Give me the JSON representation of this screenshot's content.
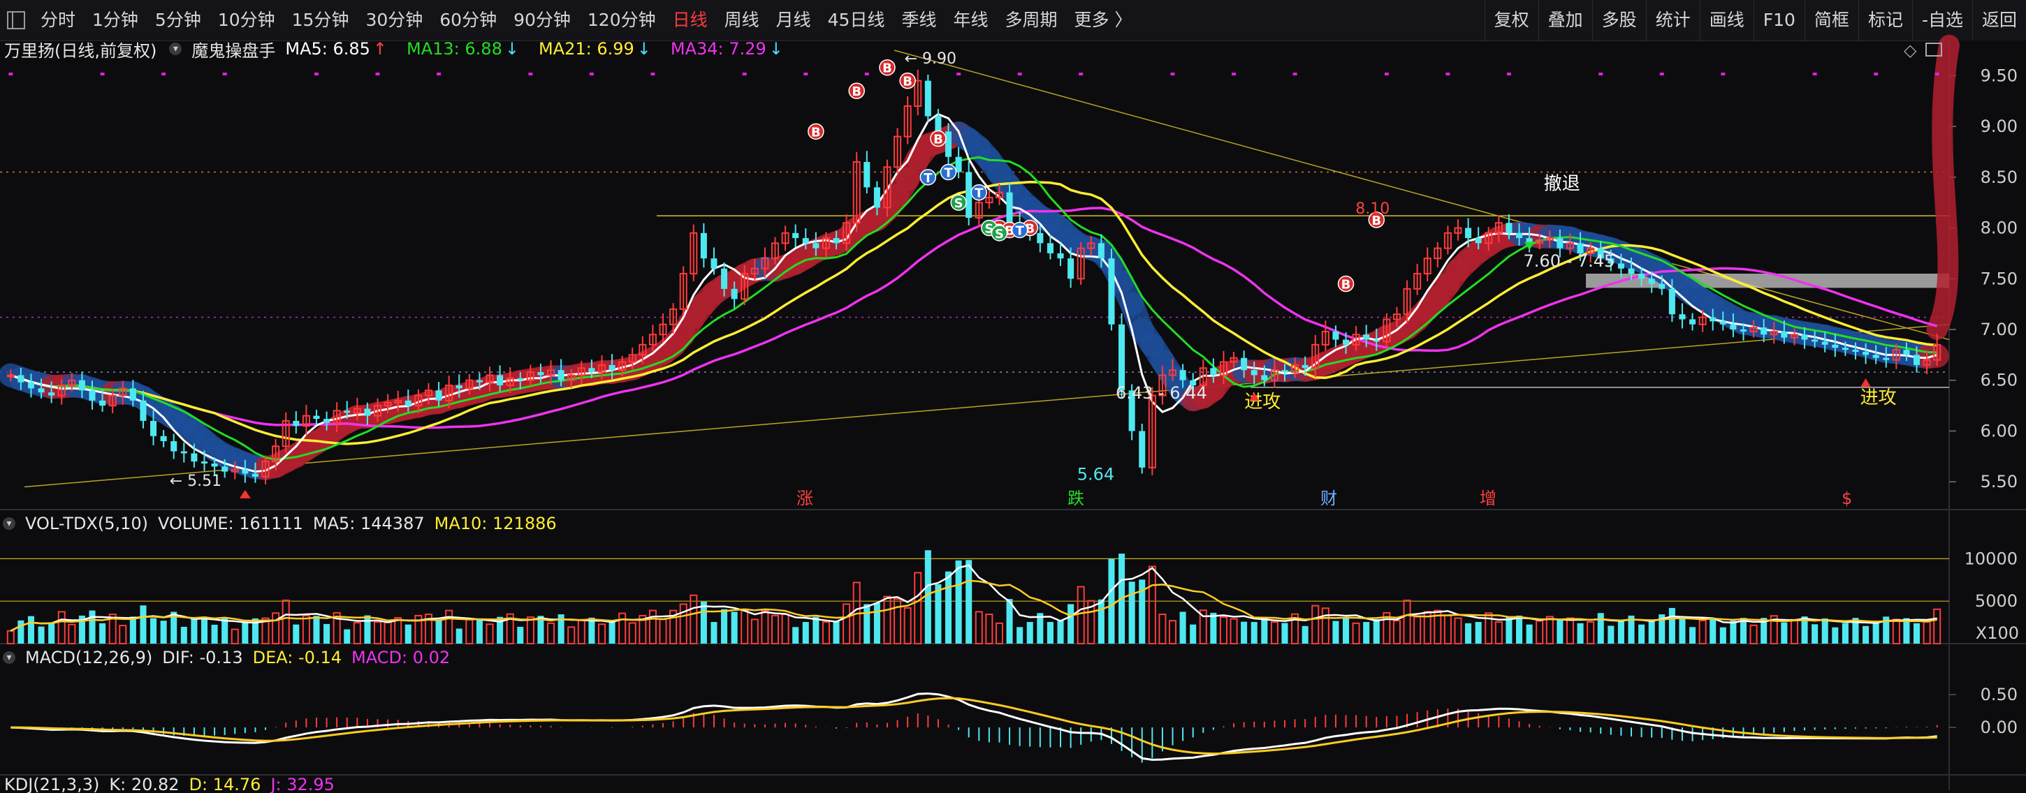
{
  "toolbar": {
    "periods": [
      "分时",
      "1分钟",
      "5分钟",
      "10分钟",
      "15分钟",
      "30分钟",
      "60分钟",
      "90分钟",
      "120分钟",
      "日线",
      "周线",
      "月线",
      "45日线",
      "季线",
      "年线",
      "多周期",
      "更多 〉"
    ],
    "active_period": "日线",
    "right_buttons": [
      "复权",
      "叠加",
      "多股",
      "统计",
      "画线",
      "F10",
      "简框",
      "标记",
      "-自选",
      "返回"
    ]
  },
  "main_panel": {
    "stock": "万里扬(日线,前复权)",
    "indicator": "魔鬼操盘手",
    "ma": [
      {
        "label": "MA5: 6.85",
        "arrow": "↑",
        "color": "#ffffff",
        "arrow_color": "#ff4040"
      },
      {
        "label": "MA13: 6.88",
        "arrow": "↓",
        "color": "#22dd22",
        "arrow_color": "#44e0ff"
      },
      {
        "label": "MA21: 6.99",
        "arrow": "↓",
        "color": "#ffee33",
        "arrow_color": "#44e0ff"
      },
      {
        "label": "MA34: 7.29",
        "arrow": "↓",
        "color": "#ee33ee",
        "arrow_color": "#44e0ff"
      }
    ],
    "annotations": {
      "high": "9.90",
      "low1": "5.51",
      "low2": "5.64",
      "range1": "6.43 - 6.44",
      "range2": "7.60 - 7.45",
      "retreat": "撤退",
      "attack1": "进攻",
      "attack2": "进攻",
      "peak2": "8.10"
    },
    "events": [
      "涨",
      "跌",
      "财",
      "增",
      "$"
    ]
  },
  "vol_panel": {
    "name": "VOL-TDX(5,10)",
    "volume": "VOLUME: 161111",
    "ma5": "MA5: 144387",
    "ma10": "MA10: 121886",
    "unit": "X100"
  },
  "macd_panel": {
    "name": "MACD(12,26,9)",
    "dif": "DIF: -0.13",
    "dea": "DEA: -0.14",
    "macd": "MACD: 0.02"
  },
  "kdj_panel": {
    "name": "KDJ(21,3,3)",
    "k": "K: 20.82",
    "d": "D: 14.76",
    "j": "J: 32.95"
  },
  "colors": {
    "up": "#ff3b3b",
    "down": "#4ee8f0",
    "ma5": "#ffffff",
    "ma13": "#22dd22",
    "ma21": "#ffee33",
    "ma34": "#ee33ee",
    "red_band": "#b3202f",
    "blue_band": "#1d4e9a"
  },
  "chart_data": [
    {
      "type": "candlestick",
      "y_ticks": [
        5.5,
        6.0,
        6.5,
        7.0,
        7.5,
        8.0,
        8.5,
        9.0,
        9.5
      ],
      "ylim": [
        5.35,
        9.75
      ],
      "close": [
        6.55,
        6.48,
        6.42,
        6.38,
        6.35,
        6.45,
        6.5,
        6.4,
        6.3,
        6.25,
        6.35,
        6.42,
        6.3,
        6.1,
        5.95,
        5.9,
        5.8,
        5.78,
        5.7,
        5.68,
        5.65,
        5.6,
        5.62,
        5.58,
        5.55,
        5.7,
        5.85,
        6.1,
        6.05,
        6.15,
        6.12,
        6.08,
        6.2,
        6.18,
        6.22,
        6.15,
        6.25,
        6.28,
        6.3,
        6.25,
        6.35,
        6.4,
        6.3,
        6.45,
        6.42,
        6.5,
        6.48,
        6.55,
        6.45,
        6.52,
        6.5,
        6.58,
        6.55,
        6.6,
        6.5,
        6.55,
        6.62,
        6.58,
        6.65,
        6.6,
        6.68,
        6.75,
        6.85,
        6.95,
        7.05,
        7.2,
        7.55,
        7.95,
        7.7,
        7.6,
        7.4,
        7.3,
        7.55,
        7.6,
        7.7,
        7.85,
        7.95,
        7.9,
        7.85,
        7.8,
        7.9,
        7.85,
        8.05,
        8.65,
        8.4,
        8.2,
        8.6,
        8.9,
        9.2,
        9.45,
        9.1,
        8.95,
        8.7,
        8.55,
        8.1,
        8.25,
        8.3,
        8.35,
        8.05,
        8.0,
        7.95,
        7.85,
        7.75,
        7.7,
        7.5,
        7.8,
        7.85,
        7.7,
        7.05,
        6.4,
        6.0,
        5.64,
        6.35,
        6.55,
        6.6,
        6.5,
        6.45,
        6.62,
        6.55,
        6.68,
        6.72,
        6.6,
        6.55,
        6.5,
        6.6,
        6.58,
        6.65,
        6.62,
        6.85,
        6.98,
        6.9,
        6.85,
        6.95,
        6.9,
        6.88,
        7.1,
        7.15,
        7.4,
        7.55,
        7.7,
        7.8,
        7.95,
        8.0,
        7.9,
        7.85,
        7.95,
        8.05,
        7.95,
        7.9,
        7.85,
        7.88,
        7.9,
        7.8,
        7.85,
        7.75,
        7.8,
        7.7,
        7.65,
        7.6,
        7.55,
        7.5,
        7.45,
        7.4,
        7.15,
        7.1,
        7.05,
        7.12,
        7.08,
        7.05,
        7.0,
        6.98,
        7.02,
        6.95,
        6.98,
        6.92,
        6.95,
        6.9,
        6.88,
        6.85,
        6.82,
        6.8,
        6.78,
        6.75,
        6.72,
        6.7,
        6.8,
        6.75,
        6.65,
        6.7,
        6.85
      ]
    },
    {
      "type": "bar",
      "name": "volume",
      "y_ticks": [
        5000,
        10000
      ],
      "ylim": [
        0,
        12500
      ]
    },
    {
      "type": "bar",
      "name": "macd",
      "y_ticks": [
        0.0,
        0.5
      ],
      "ylim": [
        -0.7,
        0.85
      ]
    }
  ]
}
